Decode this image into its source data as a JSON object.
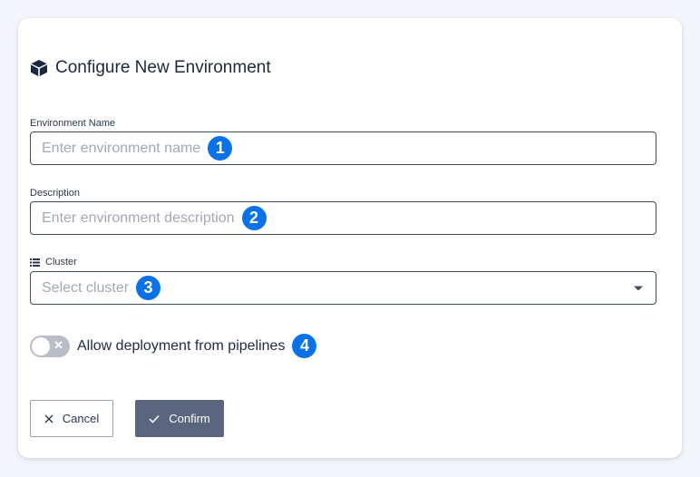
{
  "dialog": {
    "title": "Configure New Environment",
    "title_icon": "cube-icon"
  },
  "fields": {
    "name": {
      "label": "Environment Name",
      "placeholder": "Enter environment name",
      "value": "",
      "marker": "1"
    },
    "description": {
      "label": "Description",
      "placeholder": "Enter environment description",
      "value": "",
      "marker": "2"
    },
    "cluster": {
      "label": "Cluster",
      "label_icon": "list-icon",
      "placeholder": "Select cluster",
      "value": "",
      "marker": "3"
    }
  },
  "toggle": {
    "label": "Allow deployment from pipelines",
    "checked": false,
    "marker": "4"
  },
  "actions": {
    "cancel_label": "Cancel",
    "confirm_label": "Confirm"
  },
  "colors": {
    "marker": "#0a72e8",
    "confirm_button": "#5a6580",
    "toggle_off": "#b9bdc7",
    "border": "#3d4a66"
  }
}
